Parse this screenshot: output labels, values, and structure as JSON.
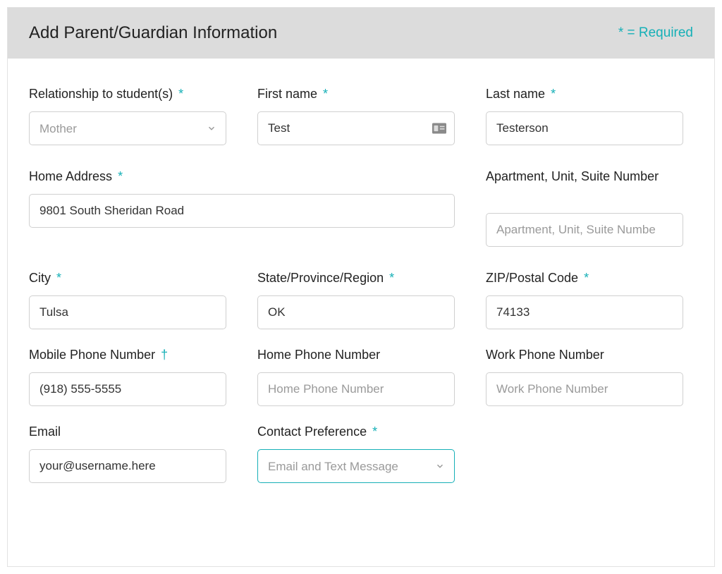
{
  "header": {
    "title": "Add Parent/Guardian Information",
    "required_legend": "* = Required"
  },
  "fields": {
    "relationship": {
      "label": "Relationship to student(s)",
      "required_mark": "*",
      "value": "Mother"
    },
    "first_name": {
      "label": "First name",
      "required_mark": "*",
      "value": "Test"
    },
    "last_name": {
      "label": "Last name",
      "required_mark": "*",
      "value": "Testerson"
    },
    "home_address": {
      "label": "Home Address",
      "required_mark": "*",
      "value": "9801 South Sheridan Road"
    },
    "apartment": {
      "label": "Apartment, Unit, Suite Number",
      "placeholder": "Apartment, Unit, Suite Numbe",
      "value": ""
    },
    "city": {
      "label": "City",
      "required_mark": "*",
      "value": "Tulsa"
    },
    "state": {
      "label": "State/Province/Region",
      "required_mark": "*",
      "value": "OK"
    },
    "zip": {
      "label": "ZIP/Postal Code",
      "required_mark": "*",
      "value": "74133"
    },
    "mobile_phone": {
      "label": "Mobile Phone Number",
      "required_mark": "†",
      "value": "(918) 555-5555"
    },
    "home_phone": {
      "label": "Home Phone Number",
      "placeholder": "Home Phone Number",
      "value": ""
    },
    "work_phone": {
      "label": "Work Phone Number",
      "placeholder": "Work Phone Number",
      "value": ""
    },
    "email": {
      "label": "Email",
      "value": "your@username.here"
    },
    "contact_pref": {
      "label": "Contact Preference",
      "required_mark": "*",
      "value": "Email and Text Message"
    }
  }
}
